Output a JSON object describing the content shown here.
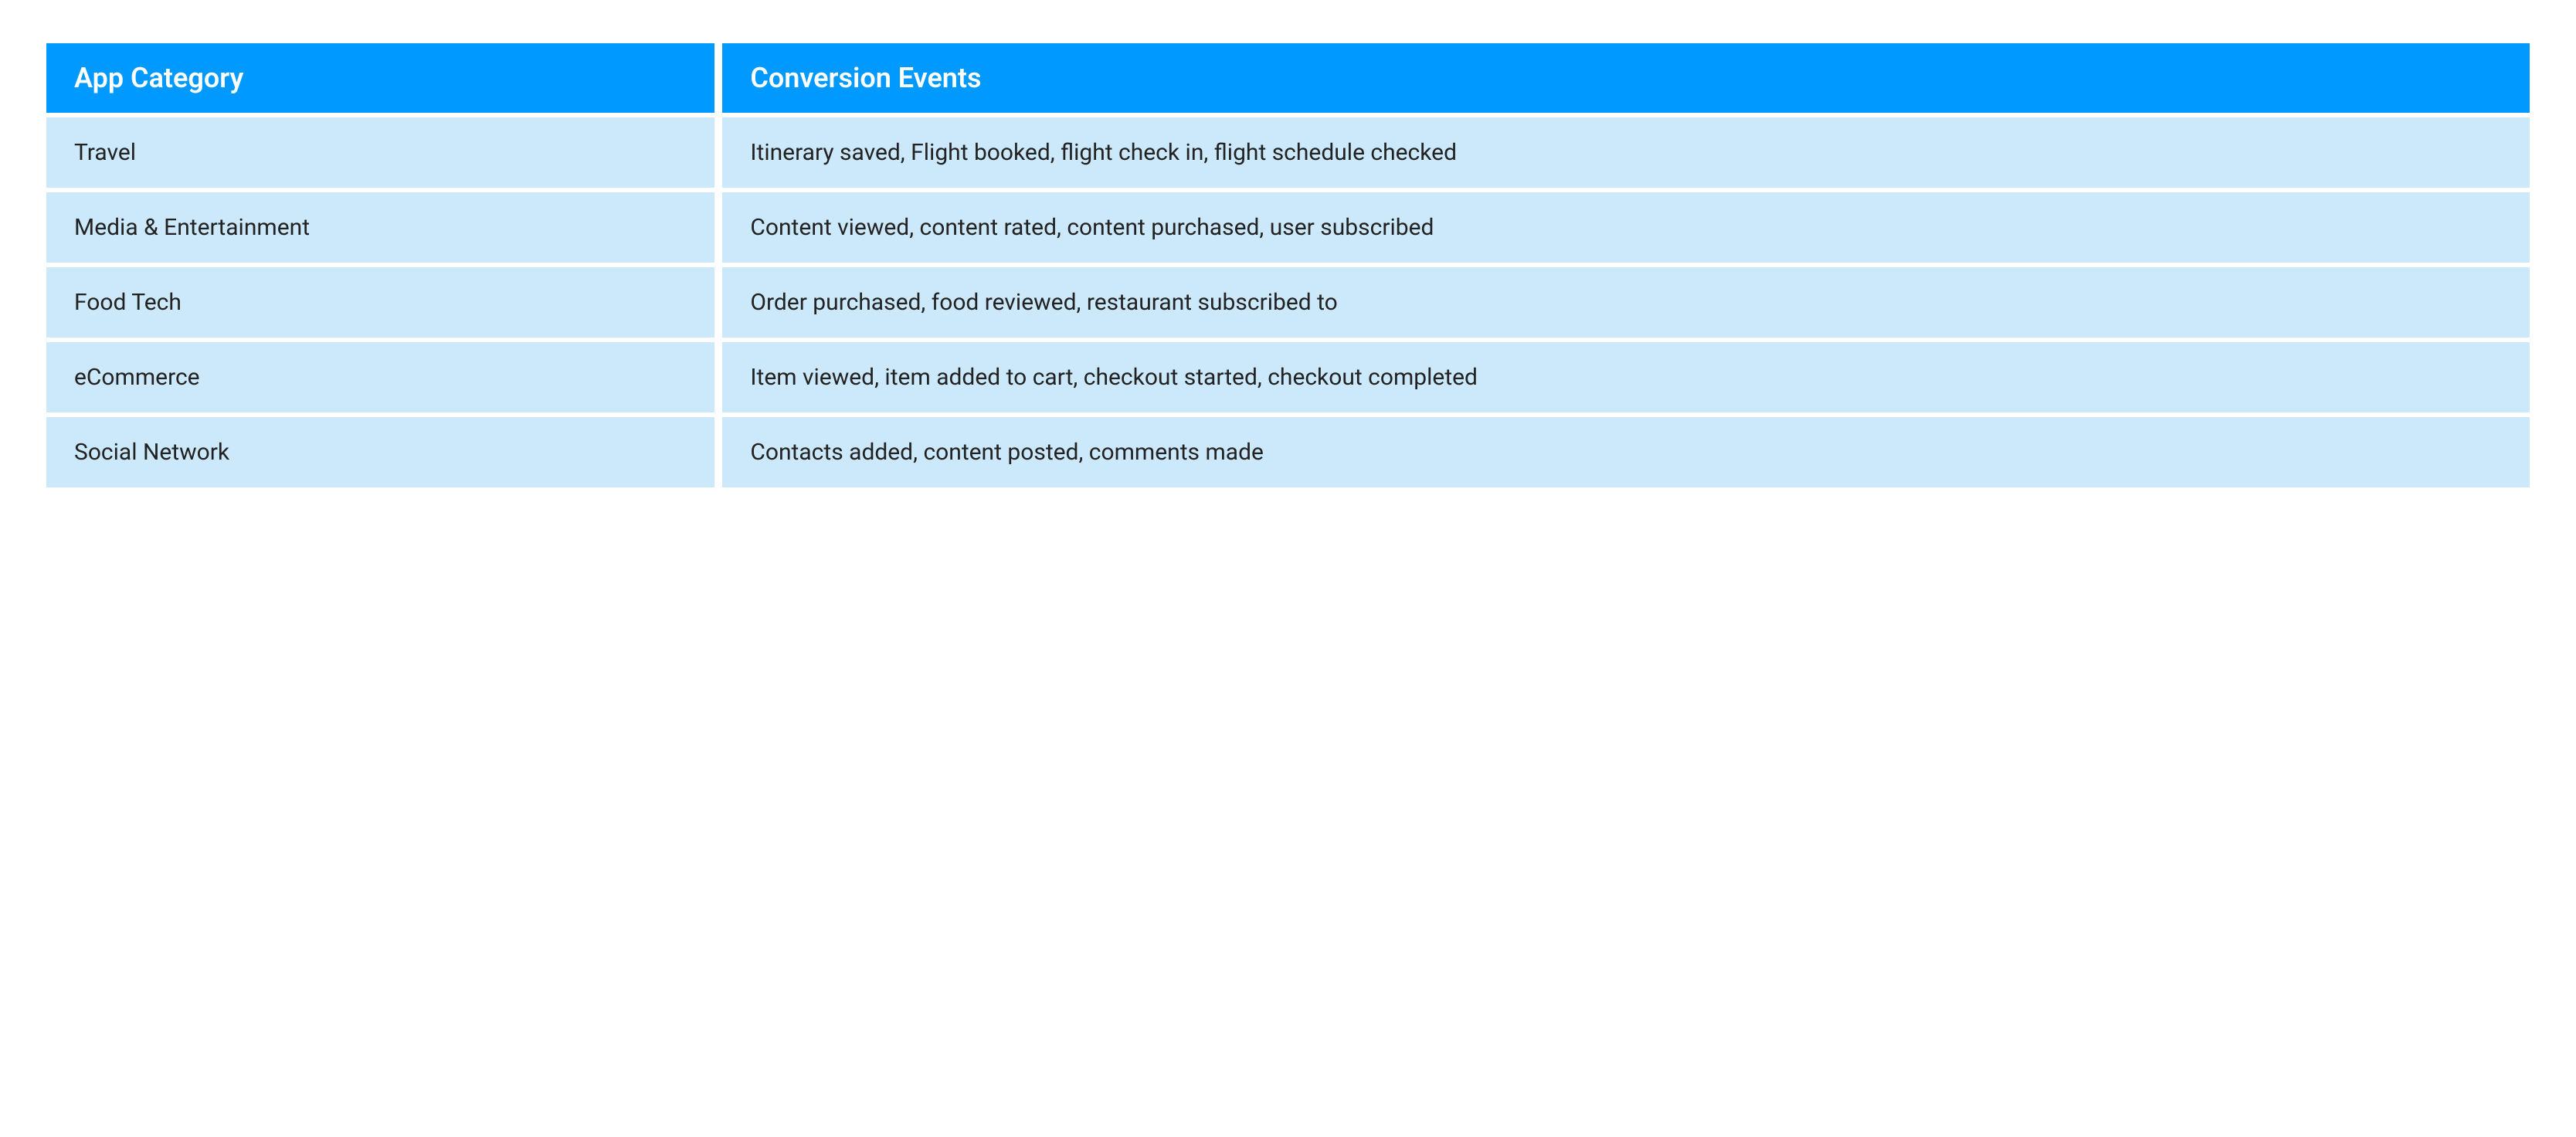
{
  "table": {
    "headers": {
      "col0": "App Category",
      "col1": "Conversion Events"
    },
    "rows": [
      {
        "category": "Travel",
        "events": "Itinerary saved, Flight booked, flight check in, flight schedule checked"
      },
      {
        "category": "Media & Entertainment",
        "events": "Content viewed, content rated, content purchased, user subscribed"
      },
      {
        "category": "Food Tech",
        "events": "Order purchased, food reviewed, restaurant subscribed to"
      },
      {
        "category": "eCommerce",
        "events": "Item viewed, item added to cart, checkout started, checkout completed"
      },
      {
        "category": "Social Network",
        "events": "Contacts added, content posted, comments made"
      }
    ]
  }
}
